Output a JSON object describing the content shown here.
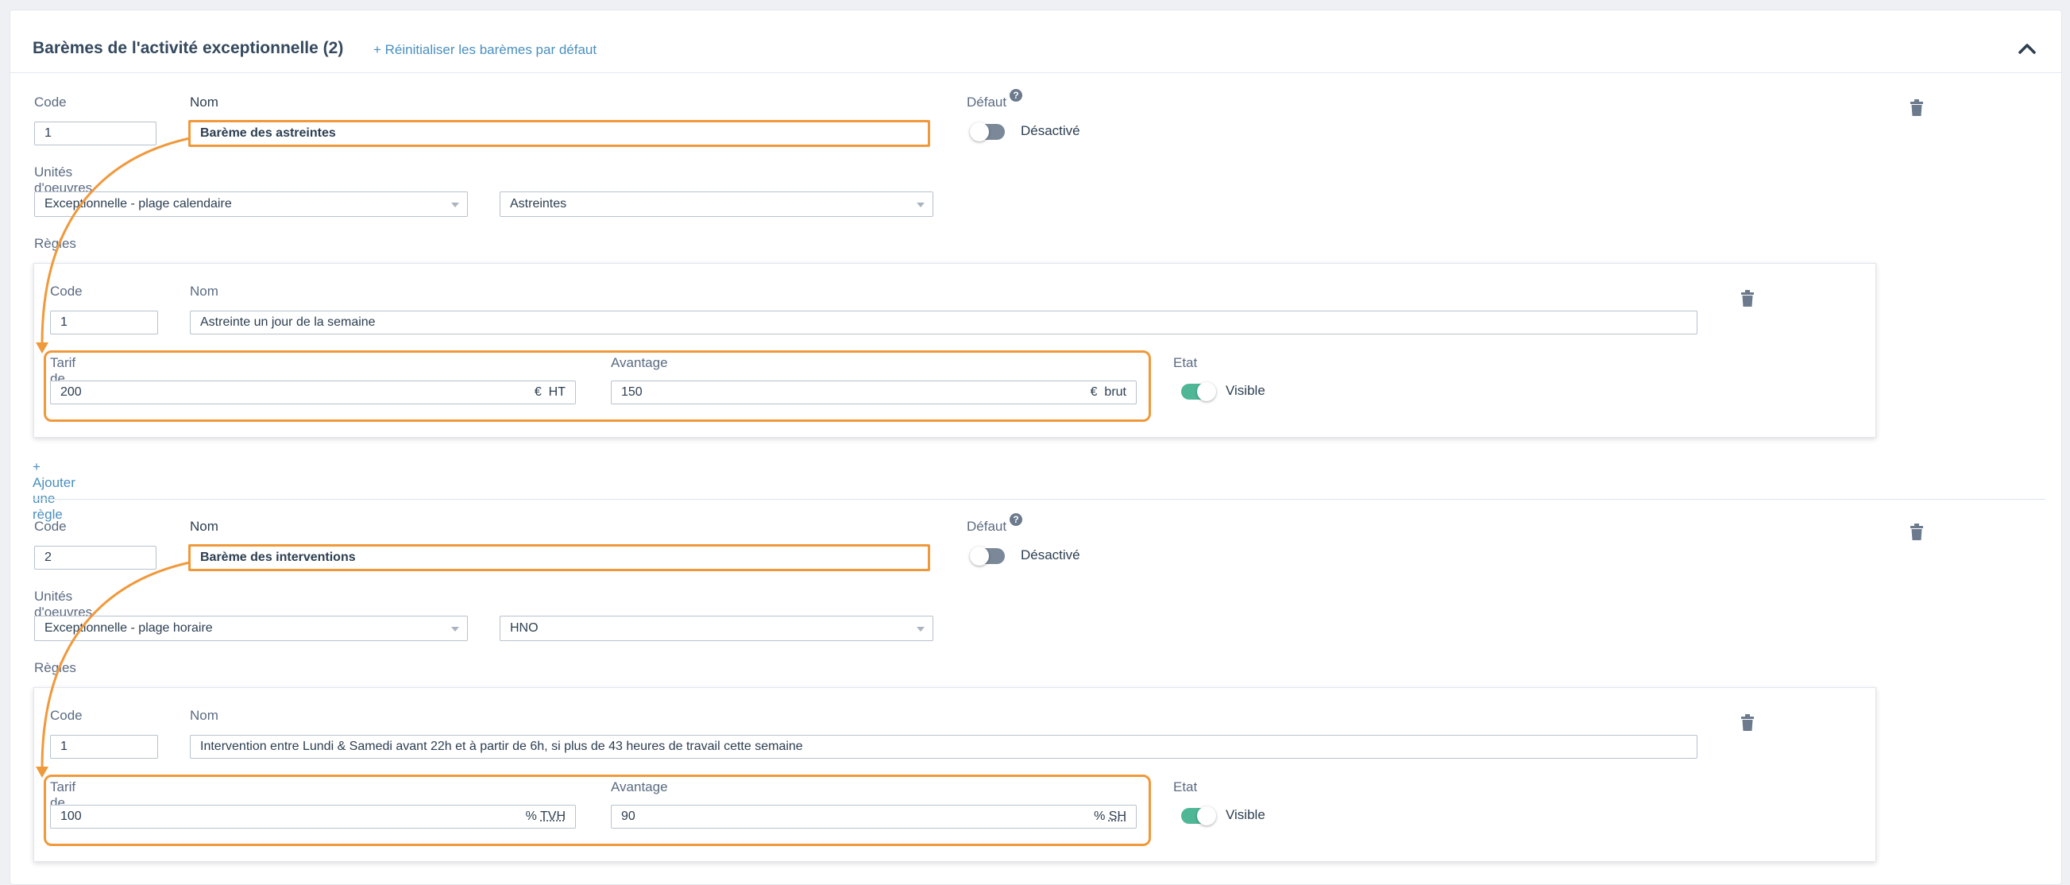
{
  "header": {
    "title": "Barèmes de l'activité exceptionnelle (2)",
    "reset_link": "+ Réinitialiser les barèmes par défaut",
    "collapse_icon": "chevron-up-icon"
  },
  "labels": {
    "code": "Code",
    "nom": "Nom",
    "defaut": "Défaut",
    "unites": "Unités d'oeuvres",
    "regles": "Règles",
    "tarif": "Tarif de vente",
    "avantage": "Avantage",
    "etat": "Etat",
    "add_rule": "+ Ajouter une règle"
  },
  "colors": {
    "accent": "#f0993b",
    "link": "#4a8fbe",
    "toggle_on": "#4fb796",
    "toggle_off": "#7a8899"
  },
  "baremes": [
    {
      "code": "1",
      "nom": "Barème des astreintes",
      "defaut_state": "Désactivé",
      "unite_type": "Exceptionnelle - plage calendaire",
      "unite_value": "Astreintes",
      "rule": {
        "code": "1",
        "nom": "Astreinte un jour de la semaine",
        "tarif": "200",
        "tarif_currency": "€",
        "tarif_unit": "HT",
        "avantage": "150",
        "avantage_currency": "€",
        "avantage_unit": "brut",
        "etat": "Visible"
      }
    },
    {
      "code": "2",
      "nom": "Barème des interventions",
      "defaut_state": "Désactivé",
      "unite_type": "Exceptionnelle - plage horaire",
      "unite_value": "HNO",
      "rule": {
        "code": "1",
        "nom": "Intervention entre Lundi & Samedi avant 22h et à partir de 6h, si plus de 43 heures de travail cette semaine",
        "tarif": "100",
        "tarif_currency": "%",
        "tarif_unit": "TVH",
        "avantage": "90",
        "avantage_currency": "%",
        "avantage_unit": "SH",
        "etat": "Visible"
      }
    }
  ]
}
